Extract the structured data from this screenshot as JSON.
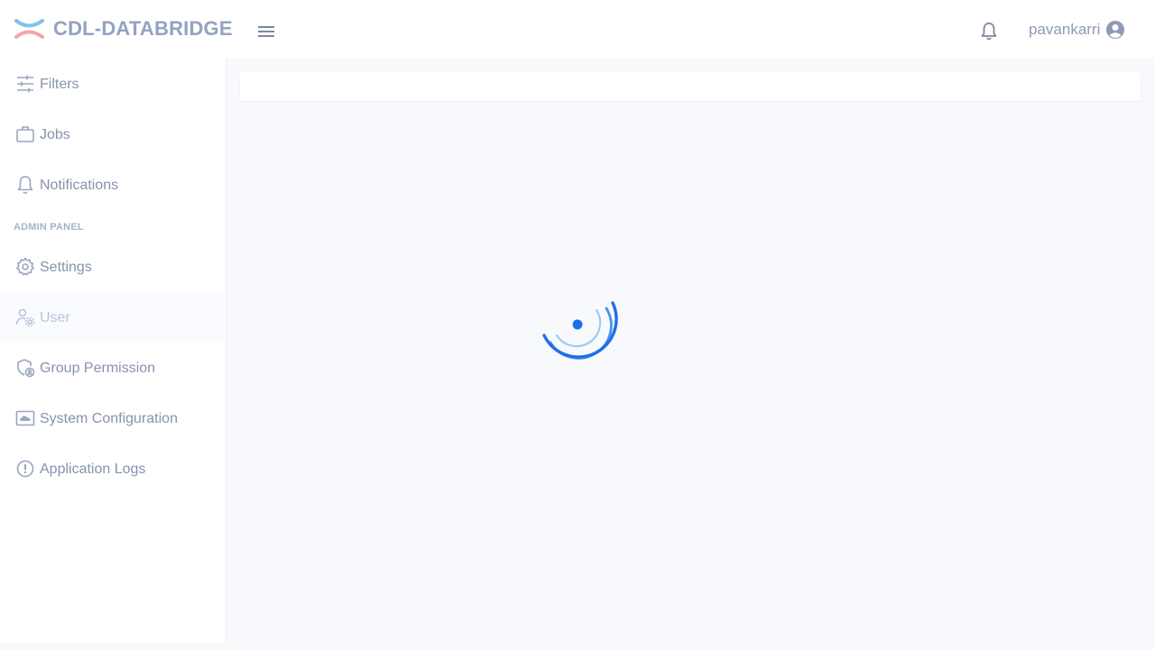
{
  "header": {
    "app_title": "CDL-DATABRIDGE",
    "logo_icon": "databridge-logo-icon",
    "menu_icon": "hamburger-menu-icon",
    "notifications_icon": "bell-icon",
    "username": "pavankarri",
    "avatar_icon": "user-circle-icon"
  },
  "sidebar": {
    "items": [
      {
        "label": "Filters",
        "icon": "sliders-icon"
      },
      {
        "label": "Jobs",
        "icon": "briefcase-icon"
      },
      {
        "label": "Notifications",
        "icon": "bell-icon"
      }
    ],
    "admin_section_title": "ADMIN PANEL",
    "admin_items": [
      {
        "label": "Settings",
        "icon": "gear-icon"
      },
      {
        "label": "User",
        "icon": "user-settings-icon",
        "active": true
      },
      {
        "label": "Group Permission",
        "icon": "shield-user-icon"
      },
      {
        "label": "System Configuration",
        "icon": "cloud-screen-icon"
      },
      {
        "label": "Application Logs",
        "icon": "alert-circle-icon"
      }
    ]
  },
  "main": {
    "loading_icon": "loading-spinner-icon"
  },
  "colors": {
    "accent_blue": "#1f6fe8",
    "logo_blue": "#7ec3ea",
    "logo_pink": "#f2a5ad",
    "text_muted": "#8693ad"
  }
}
